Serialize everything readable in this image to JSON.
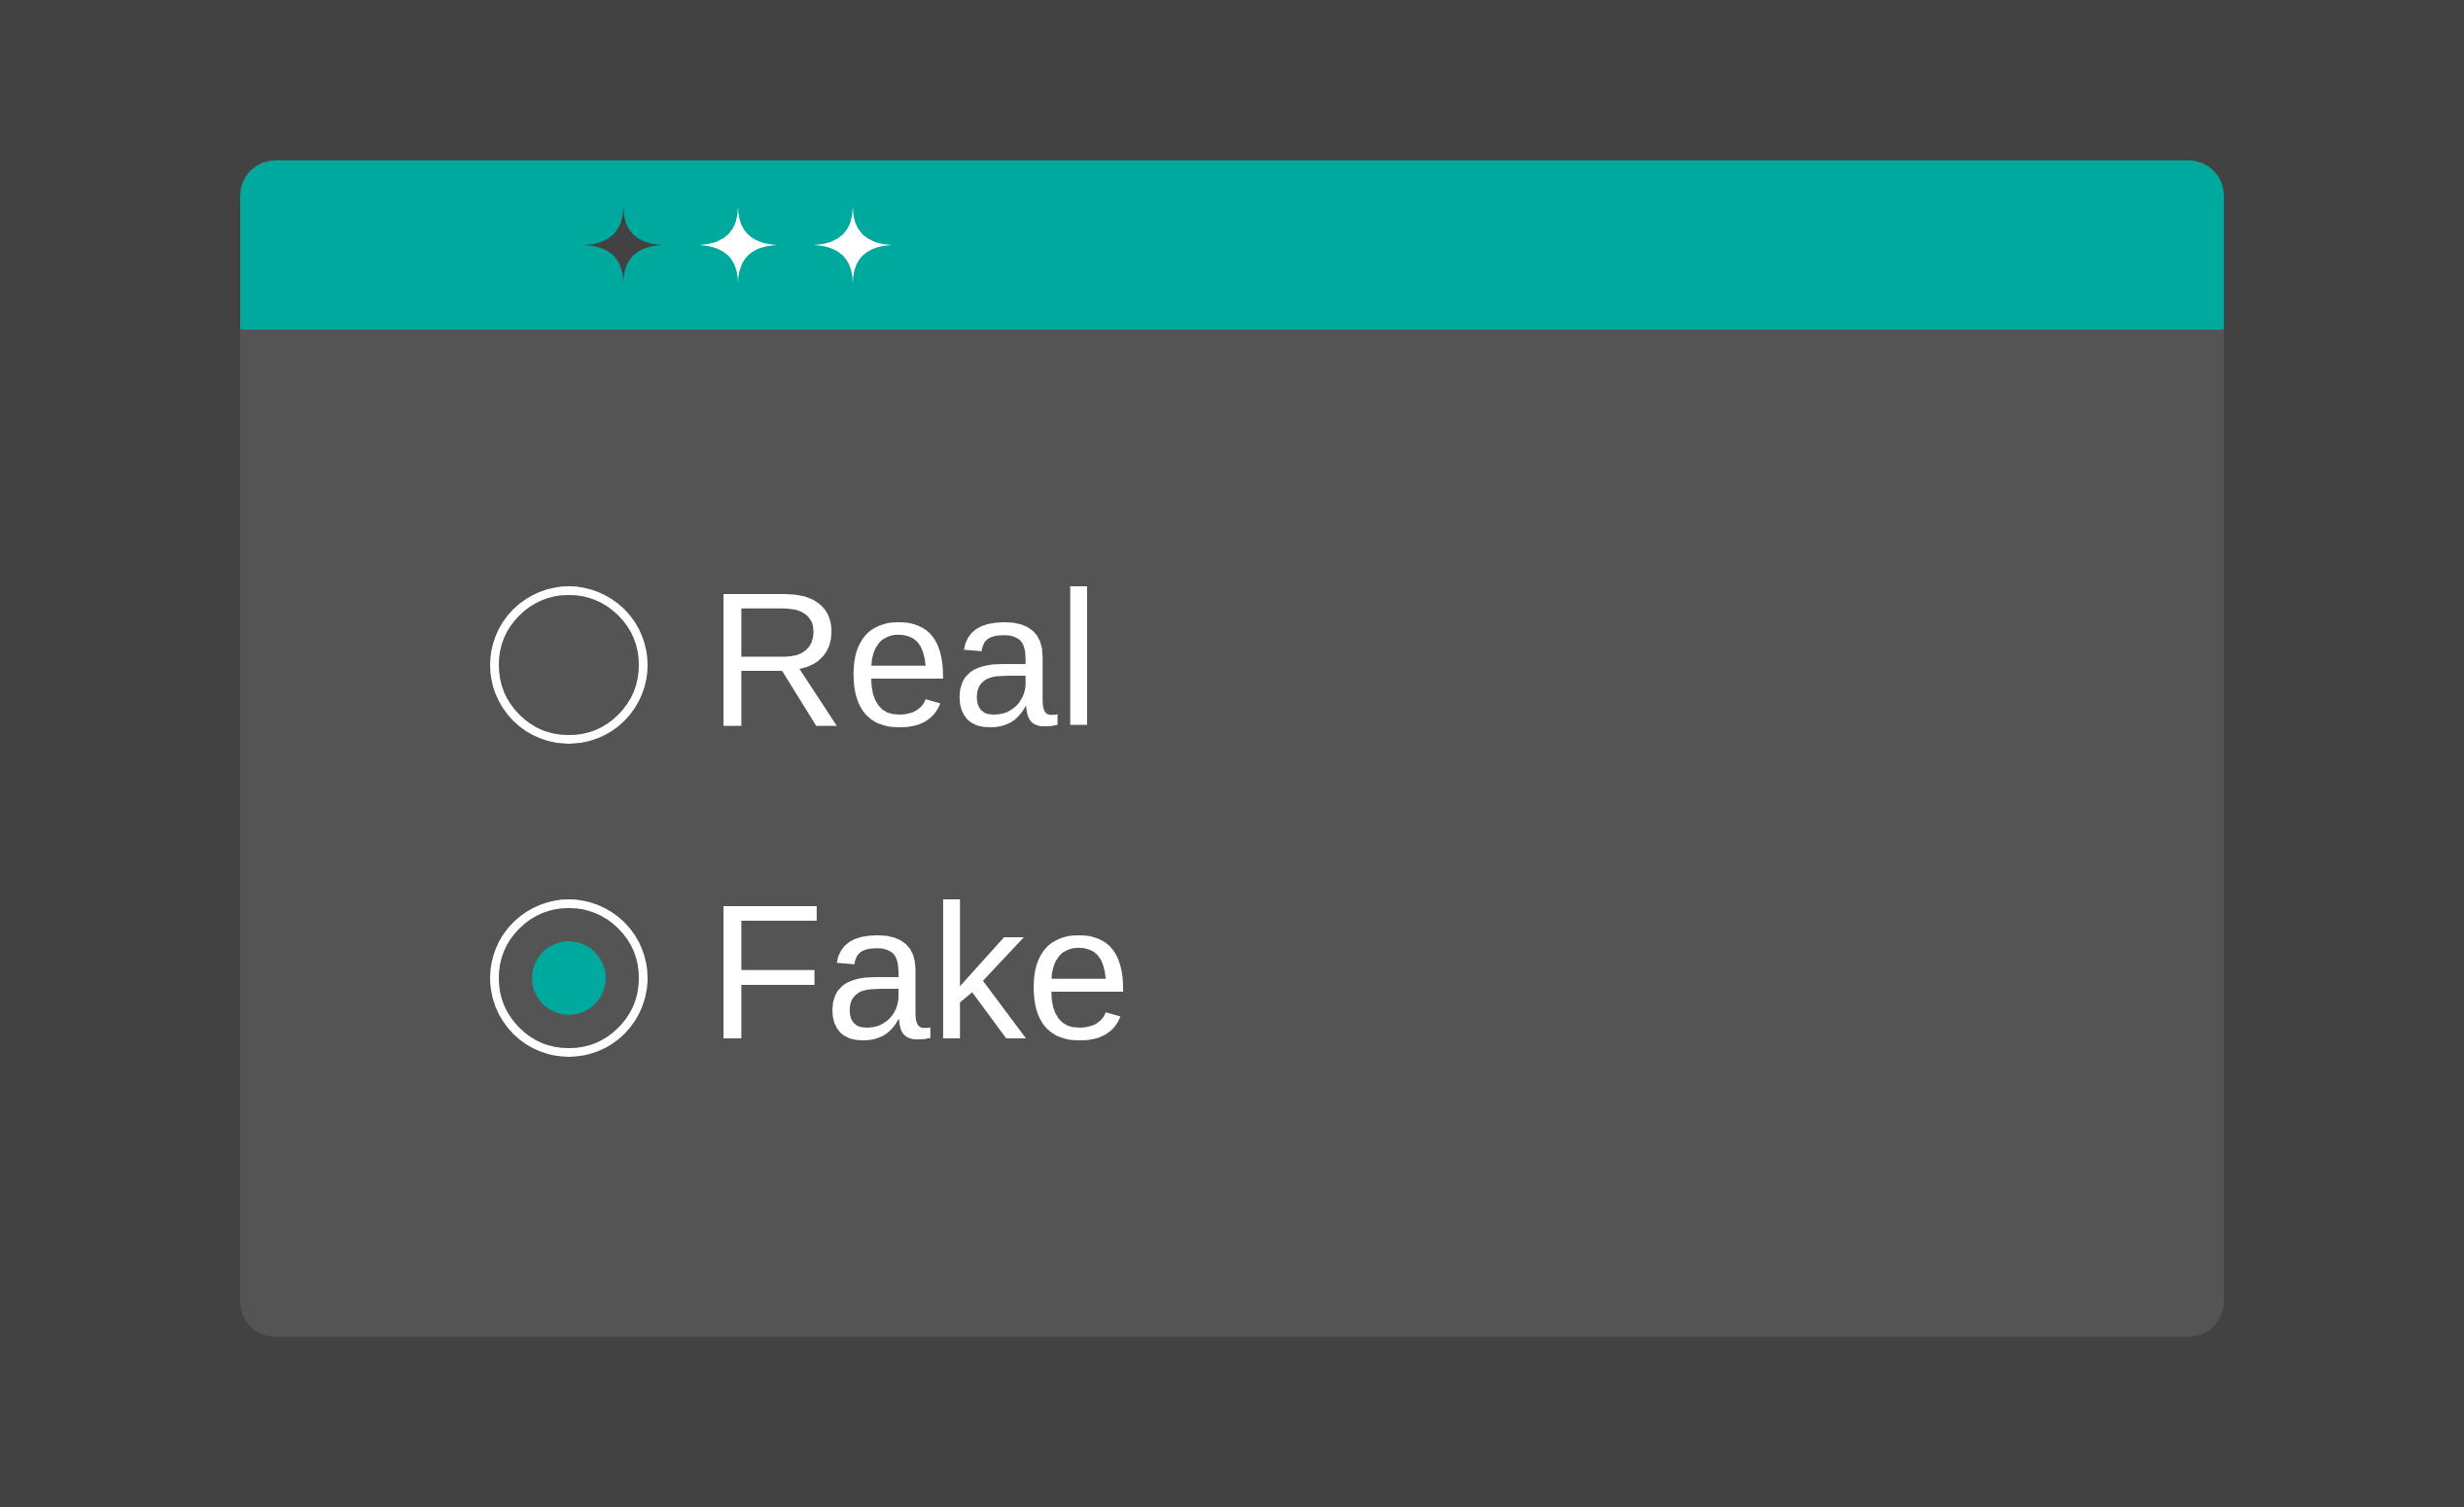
{
  "title_bar": {
    "icons": [
      {
        "color": "#424242"
      },
      {
        "color": "#ffffff"
      },
      {
        "color": "#ffffff"
      }
    ]
  },
  "options": [
    {
      "label": "Real",
      "selected": false
    },
    {
      "label": "Fake",
      "selected": true
    }
  ]
}
